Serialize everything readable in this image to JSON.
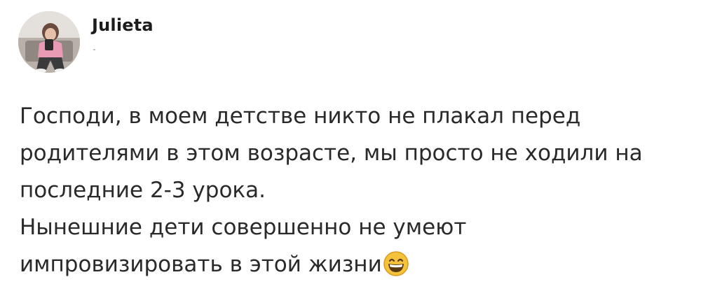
{
  "post": {
    "author": "Julieta",
    "lines": [
      "Господи, в моем детстве никто не плакал перед",
      "родителями в этом возрасте, мы просто не ходили на",
      "последние 2-3 урока.",
      "Нынешние дети совершенно не умеют",
      "импровизировать в этой жизни"
    ],
    "emoji": "grinning-face-with-smiling-eyes"
  },
  "colors": {
    "text": "#2a2a2a",
    "author": "#1c1c1c",
    "emoji_face": "#f5c33b"
  }
}
